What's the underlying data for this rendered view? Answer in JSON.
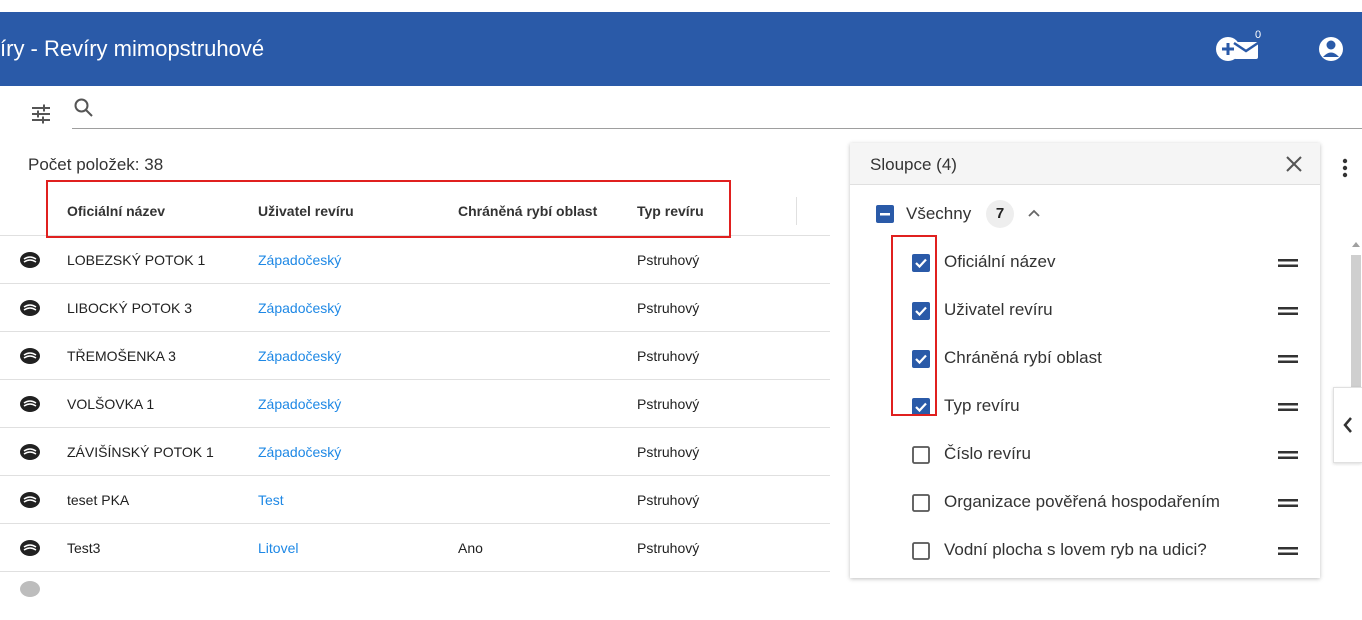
{
  "header": {
    "title": "íry - Revíry mimopstruhové",
    "mail_count": "0",
    "icons": [
      "plus-circle-icon",
      "mail-icon",
      "account-icon"
    ],
    "color": "#2a5aa8"
  },
  "toolbar": {
    "icons": [
      "filter-settings-icon",
      "search-icon"
    ],
    "search_value": ""
  },
  "list": {
    "count_label": "Počet položek: 38",
    "columns": [
      "Oficiální název",
      "Uživatel revíru",
      "Chráněná rybí oblast",
      "Typ revíru"
    ],
    "rows": [
      {
        "name": "LOBEZSKÝ POTOK 1",
        "user": "Západočeský",
        "protected": "",
        "type": "Pstruhový"
      },
      {
        "name": "LIBOCKÝ POTOK 3",
        "user": "Západočeský",
        "protected": "",
        "type": "Pstruhový"
      },
      {
        "name": "TŘEMOŠENKA 3",
        "user": "Západočeský",
        "protected": "",
        "type": "Pstruhový"
      },
      {
        "name": "VOLŠOVKA 1",
        "user": "Západočeský",
        "protected": "",
        "type": "Pstruhový"
      },
      {
        "name": "ZÁVIŠÍNSKÝ POTOK 1",
        "user": "Západočeský",
        "protected": "",
        "type": "Pstruhový"
      },
      {
        "name": "teset PKA",
        "user": "Test",
        "protected": "",
        "type": "Pstruhový"
      },
      {
        "name": "Test3",
        "user": "Litovel",
        "protected": "Ano",
        "type": "Pstruhový"
      }
    ],
    "link_color": "#1e88e5"
  },
  "columns_panel": {
    "title": "Sloupce (4)",
    "all_label": "Všechny",
    "all_count": "7",
    "items": [
      {
        "label": "Oficiální název",
        "checked": true
      },
      {
        "label": "Uživatel revíru",
        "checked": true
      },
      {
        "label": "Chráněná rybí oblast",
        "checked": true
      },
      {
        "label": "Typ revíru",
        "checked": true
      },
      {
        "label": "Číslo revíru",
        "checked": false
      },
      {
        "label": "Organizace pověřená hospodařením",
        "checked": false
      },
      {
        "label": "Vodní plocha s lovem ryb na udici?",
        "checked": false
      }
    ]
  },
  "highlight_color": "#e0201f"
}
